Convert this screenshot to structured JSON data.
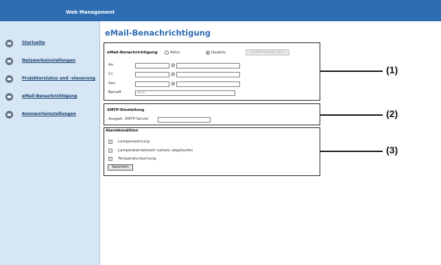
{
  "header": {
    "title": "Web Management"
  },
  "sidebar": {
    "items": [
      {
        "label": "Startseite"
      },
      {
        "label": "Netzwerkeinstellungen"
      },
      {
        "label": "Projektorstatus und -steuerung"
      },
      {
        "label": "eMail-Benachrichtigung"
      },
      {
        "label": "Kennworteinstellungen"
      }
    ]
  },
  "main": {
    "title": "eMail-Benachrichtigung",
    "email_section": {
      "label": "eMail-Benachrichtigung",
      "option_on": "Aktiv.",
      "option_off": "Deaktiv.",
      "selected": "Deaktiv.",
      "test_button": "E-Mail Deakti. Test",
      "fields": [
        {
          "label": "An",
          "at": "@"
        },
        {
          "label": "Cc",
          "at": "@"
        },
        {
          "label": "Von",
          "at": "@"
        }
      ],
      "subject_label": "Betreff",
      "subject_value": "Alrm"
    },
    "smtp_section": {
      "title": "SMTP-Einstellung",
      "server_label": "Ausgeh. SMTP-Server",
      "server_value": ""
    },
    "alarm_section": {
      "title": "Alarmkondition",
      "items": [
        {
          "label": "Lampenwarnung",
          "checked": false
        },
        {
          "label": "Lampenbetriebszeit nahezu abgelaufen",
          "checked": false
        },
        {
          "label": "Temperaturwarnung",
          "checked": false
        }
      ],
      "apply_button": "Speichern"
    }
  },
  "callouts": [
    "(1)",
    "(2)",
    "(3)"
  ],
  "colors": {
    "header": "#2e6db4",
    "sidebar": "#d6e6f5",
    "title": "#2e6db4"
  }
}
